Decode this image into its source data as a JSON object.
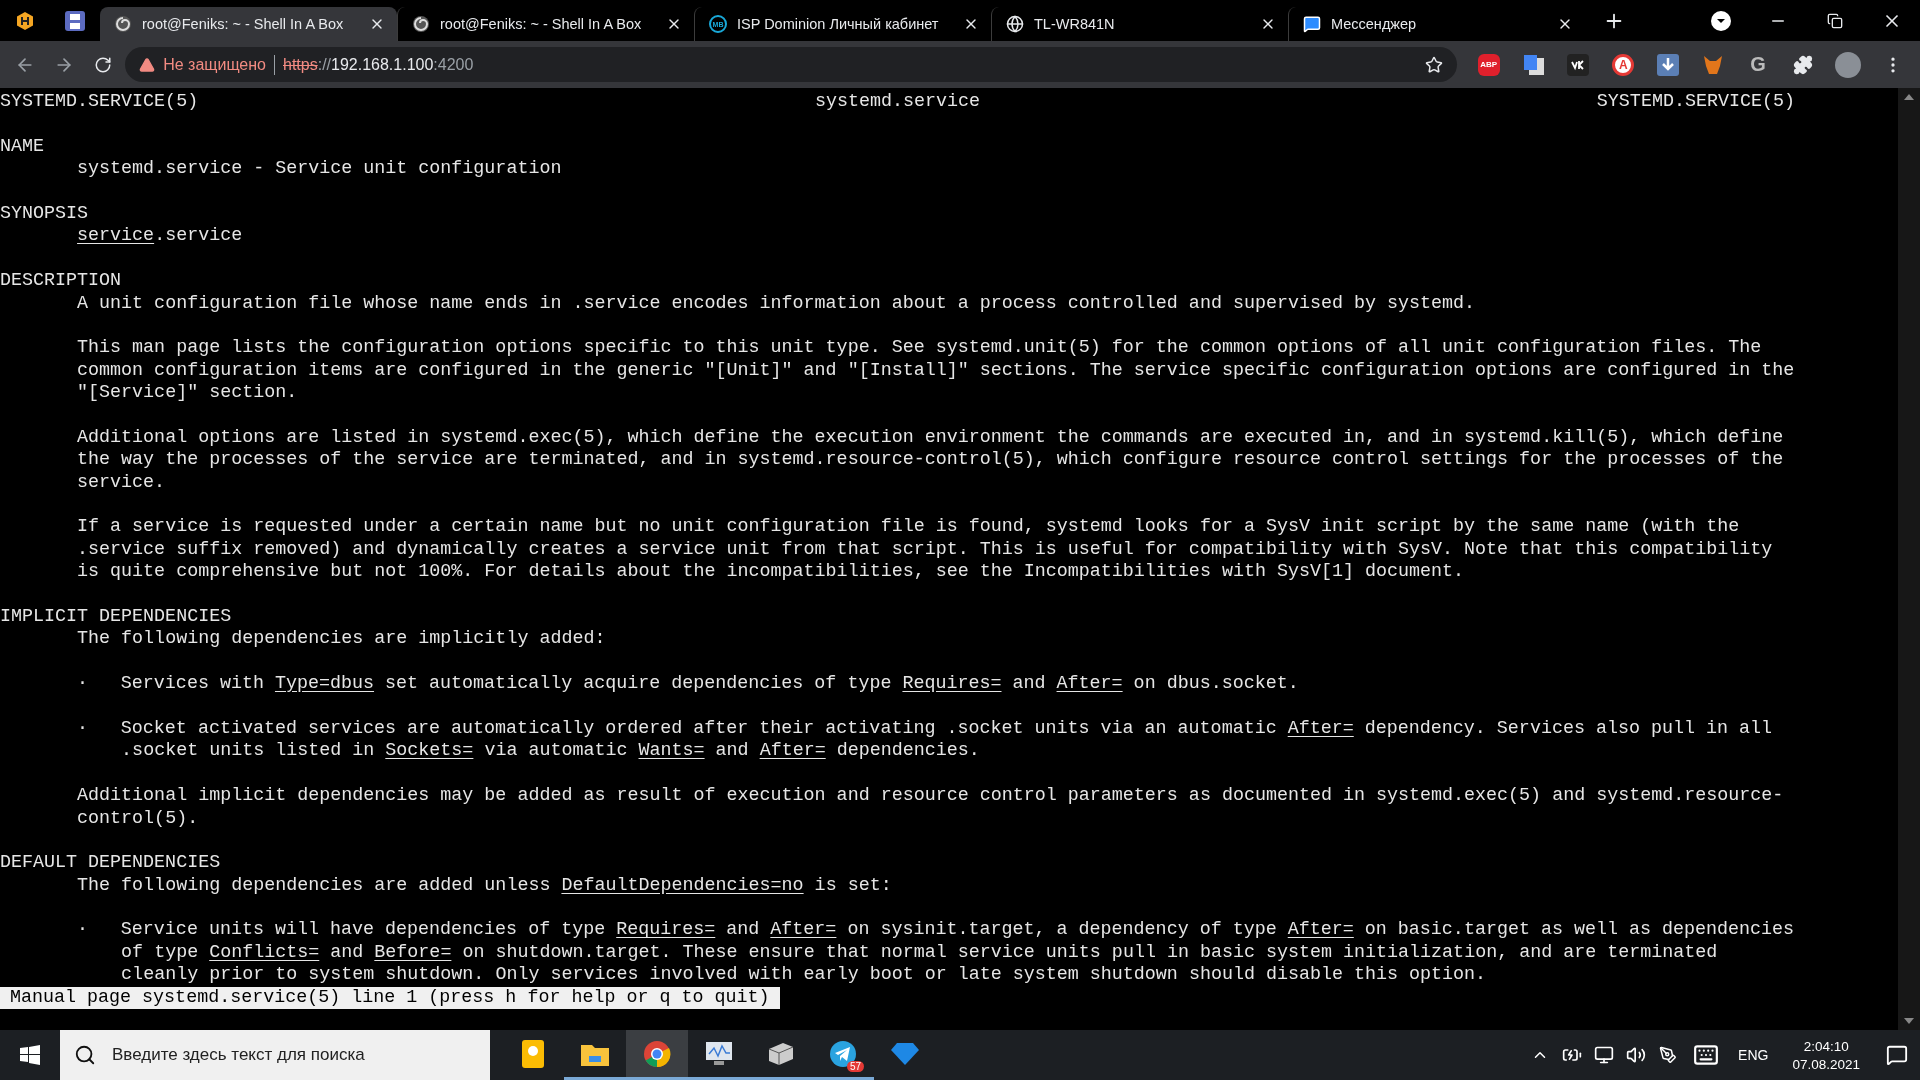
{
  "browser": {
    "pinned_tabs": [
      {
        "kind": "hex"
      },
      {
        "kind": "floppy"
      }
    ],
    "tabs": [
      {
        "title": "root@Feniks: ~ - Shell In A Box",
        "kind": "swirl",
        "selected": true
      },
      {
        "title": "root@Feniks: ~ - Shell In A Box",
        "kind": "swirl",
        "selected": false
      },
      {
        "title": "ISP Dominion Личный кабинет",
        "kind": "mb",
        "icon_text": "MB",
        "selected": false
      },
      {
        "title": "TL-WR841N",
        "kind": "globe",
        "selected": false
      },
      {
        "title": "Мессенджер",
        "kind": "chat",
        "selected": false
      }
    ],
    "security_label": "Не защищено",
    "url_scheme": "https",
    "url_sep": "://",
    "url_host": "192.168.1.100",
    "url_port": ":4200",
    "extensions": [
      {
        "kind": "abp",
        "text": "ABP"
      },
      {
        "kind": "translate"
      },
      {
        "kind": "vk"
      },
      {
        "kind": "circle_a",
        "text": "A"
      },
      {
        "kind": "download"
      },
      {
        "kind": "fox"
      },
      {
        "kind": "g",
        "text": "G"
      },
      {
        "kind": "puzzle"
      },
      {
        "kind": "avatar"
      }
    ]
  },
  "terminal": {
    "header": {
      "left": "SYSTEMD.SERVICE(5)",
      "center": "systemd.service",
      "right": "SYSTEMD.SERVICE(5)"
    },
    "lines": [
      {
        "kind": "blank"
      },
      {
        "kind": "heading",
        "text": "NAME"
      },
      {
        "kind": "body",
        "segments": [
          {
            "text": "systemd.service - Service unit configuration",
            "underlined": false
          }
        ]
      },
      {
        "kind": "blank"
      },
      {
        "kind": "heading",
        "text": "SYNOPSIS"
      },
      {
        "kind": "body",
        "segments": [
          {
            "text": "service",
            "underlined": true
          },
          {
            "text": ".service",
            "underlined": false
          }
        ]
      },
      {
        "kind": "blank"
      },
      {
        "kind": "heading",
        "text": "DESCRIPTION"
      },
      {
        "kind": "body",
        "segments": [
          {
            "text": "A unit configuration file whose name ends in .service encodes information about a process controlled and supervised by systemd.",
            "underlined": false
          }
        ]
      },
      {
        "kind": "blank"
      },
      {
        "kind": "body",
        "segments": [
          {
            "text": "This man page lists the configuration options specific to this unit type. See systemd.unit(5) for the common options of all unit configuration files. The",
            "underlined": false
          }
        ]
      },
      {
        "kind": "body",
        "segments": [
          {
            "text": "common configuration items are configured in the generic \"[Unit]\" and \"[Install]\" sections. The service specific configuration options are configured in the",
            "underlined": false
          }
        ]
      },
      {
        "kind": "body",
        "segments": [
          {
            "text": "\"[Service]\" section.",
            "underlined": false
          }
        ]
      },
      {
        "kind": "blank"
      },
      {
        "kind": "body",
        "segments": [
          {
            "text": "Additional options are listed in systemd.exec(5), which define the execution environment the commands are executed in, and in systemd.kill(5), which define",
            "underlined": false
          }
        ]
      },
      {
        "kind": "body",
        "segments": [
          {
            "text": "the way the processes of the service are terminated, and in systemd.resource-control(5), which configure resource control settings for the processes of the",
            "underlined": false
          }
        ]
      },
      {
        "kind": "body",
        "segments": [
          {
            "text": "service.",
            "underlined": false
          }
        ]
      },
      {
        "kind": "blank"
      },
      {
        "kind": "body",
        "segments": [
          {
            "text": "If a service is requested under a certain name but no unit configuration file is found, systemd looks for a SysV init script by the same name (with the",
            "underlined": false
          }
        ]
      },
      {
        "kind": "body",
        "segments": [
          {
            "text": ".service suffix removed) and dynamically creates a service unit from that script. This is useful for compatibility with SysV. Note that this compatibility",
            "underlined": false
          }
        ]
      },
      {
        "kind": "body",
        "segments": [
          {
            "text": "is quite comprehensive but not 100%. For details about the incompatibilities, see the Incompatibilities with SysV[1] document.",
            "underlined": false
          }
        ]
      },
      {
        "kind": "blank"
      },
      {
        "kind": "heading",
        "text": "IMPLICIT DEPENDENCIES"
      },
      {
        "kind": "body",
        "segments": [
          {
            "text": "The following dependencies are implicitly added:",
            "underlined": false
          }
        ]
      },
      {
        "kind": "blank"
      },
      {
        "kind": "bullet",
        "mark": "·",
        "segments": [
          {
            "text": "Services with ",
            "underlined": false
          },
          {
            "text": "Type=dbus",
            "underlined": true
          },
          {
            "text": " set automatically acquire dependencies of type ",
            "underlined": false
          },
          {
            "text": "Requires=",
            "underlined": true
          },
          {
            "text": " and ",
            "underlined": false
          },
          {
            "text": "After=",
            "underlined": true
          },
          {
            "text": " on dbus.socket.",
            "underlined": false
          }
        ]
      },
      {
        "kind": "blank"
      },
      {
        "kind": "bullet",
        "mark": "·",
        "segments": [
          {
            "text": "Socket activated services are automatically ordered after their activating .socket units via an automatic ",
            "underlined": false
          },
          {
            "text": "After=",
            "underlined": true
          },
          {
            "text": " dependency. Services also pull in all",
            "underlined": false
          }
        ]
      },
      {
        "kind": "continuation",
        "segments": [
          {
            "text": ".socket units listed in ",
            "underlined": false
          },
          {
            "text": "Sockets=",
            "underlined": true
          },
          {
            "text": " via automatic ",
            "underlined": false
          },
          {
            "text": "Wants=",
            "underlined": true
          },
          {
            "text": " and ",
            "underlined": false
          },
          {
            "text": "After=",
            "underlined": true
          },
          {
            "text": " dependencies.",
            "underlined": false
          }
        ]
      },
      {
        "kind": "blank"
      },
      {
        "kind": "body",
        "segments": [
          {
            "text": "Additional implicit dependencies may be added as result of execution and resource control parameters as documented in systemd.exec(5) and systemd.resource-",
            "underlined": false
          }
        ]
      },
      {
        "kind": "body",
        "segments": [
          {
            "text": "control(5).",
            "underlined": false
          }
        ]
      },
      {
        "kind": "blank"
      },
      {
        "kind": "heading",
        "text": "DEFAULT DEPENDENCIES"
      },
      {
        "kind": "body",
        "segments": [
          {
            "text": "The following dependencies are added unless ",
            "underlined": false
          },
          {
            "text": "DefaultDependencies=no",
            "underlined": true
          },
          {
            "text": " is set:",
            "underlined": false
          }
        ]
      },
      {
        "kind": "blank"
      },
      {
        "kind": "bullet",
        "mark": "·",
        "segments": [
          {
            "text": "Service units will have dependencies of type ",
            "underlined": false
          },
          {
            "text": "Requires=",
            "underlined": true
          },
          {
            "text": " and ",
            "underlined": false
          },
          {
            "text": "After=",
            "underlined": true
          },
          {
            "text": " on sysinit.target, a dependency of type ",
            "underlined": false
          },
          {
            "text": "After=",
            "underlined": true
          },
          {
            "text": " on basic.target as well as dependencies",
            "underlined": false
          }
        ]
      },
      {
        "kind": "continuation",
        "segments": [
          {
            "text": "of type ",
            "underlined": false
          },
          {
            "text": "Conflicts=",
            "underlined": true
          },
          {
            "text": " and ",
            "underlined": false
          },
          {
            "text": "Before=",
            "underlined": true
          },
          {
            "text": " on shutdown.target. These ensure that normal service units pull in basic system initialization, and are terminated",
            "underlined": false
          }
        ]
      },
      {
        "kind": "continuation",
        "segments": [
          {
            "text": "cleanly prior to system shutdown. Only services involved with early boot or late system shutdown should disable this option.",
            "underlined": false
          }
        ]
      }
    ],
    "status_line": "Manual page systemd.service(5) line 1 (press h for help or q to quit)"
  },
  "taskbar": {
    "search": {
      "placeholder": "Введите здесь текст для поиска"
    },
    "apps": [
      {
        "kind": "note",
        "running": false,
        "selected": false
      },
      {
        "kind": "folder",
        "running": true,
        "selected": false
      },
      {
        "kind": "chrome",
        "running": true,
        "selected": true
      },
      {
        "kind": "monitor",
        "running": true,
        "selected": false
      },
      {
        "kind": "box",
        "running": true,
        "selected": false
      },
      {
        "kind": "telegram",
        "badge": "57",
        "running": true,
        "selected": false
      },
      {
        "kind": "diamond",
        "running": false,
        "selected": false
      }
    ],
    "language": "ENG",
    "time": "2:04:10",
    "date": "07.08.2021"
  }
}
